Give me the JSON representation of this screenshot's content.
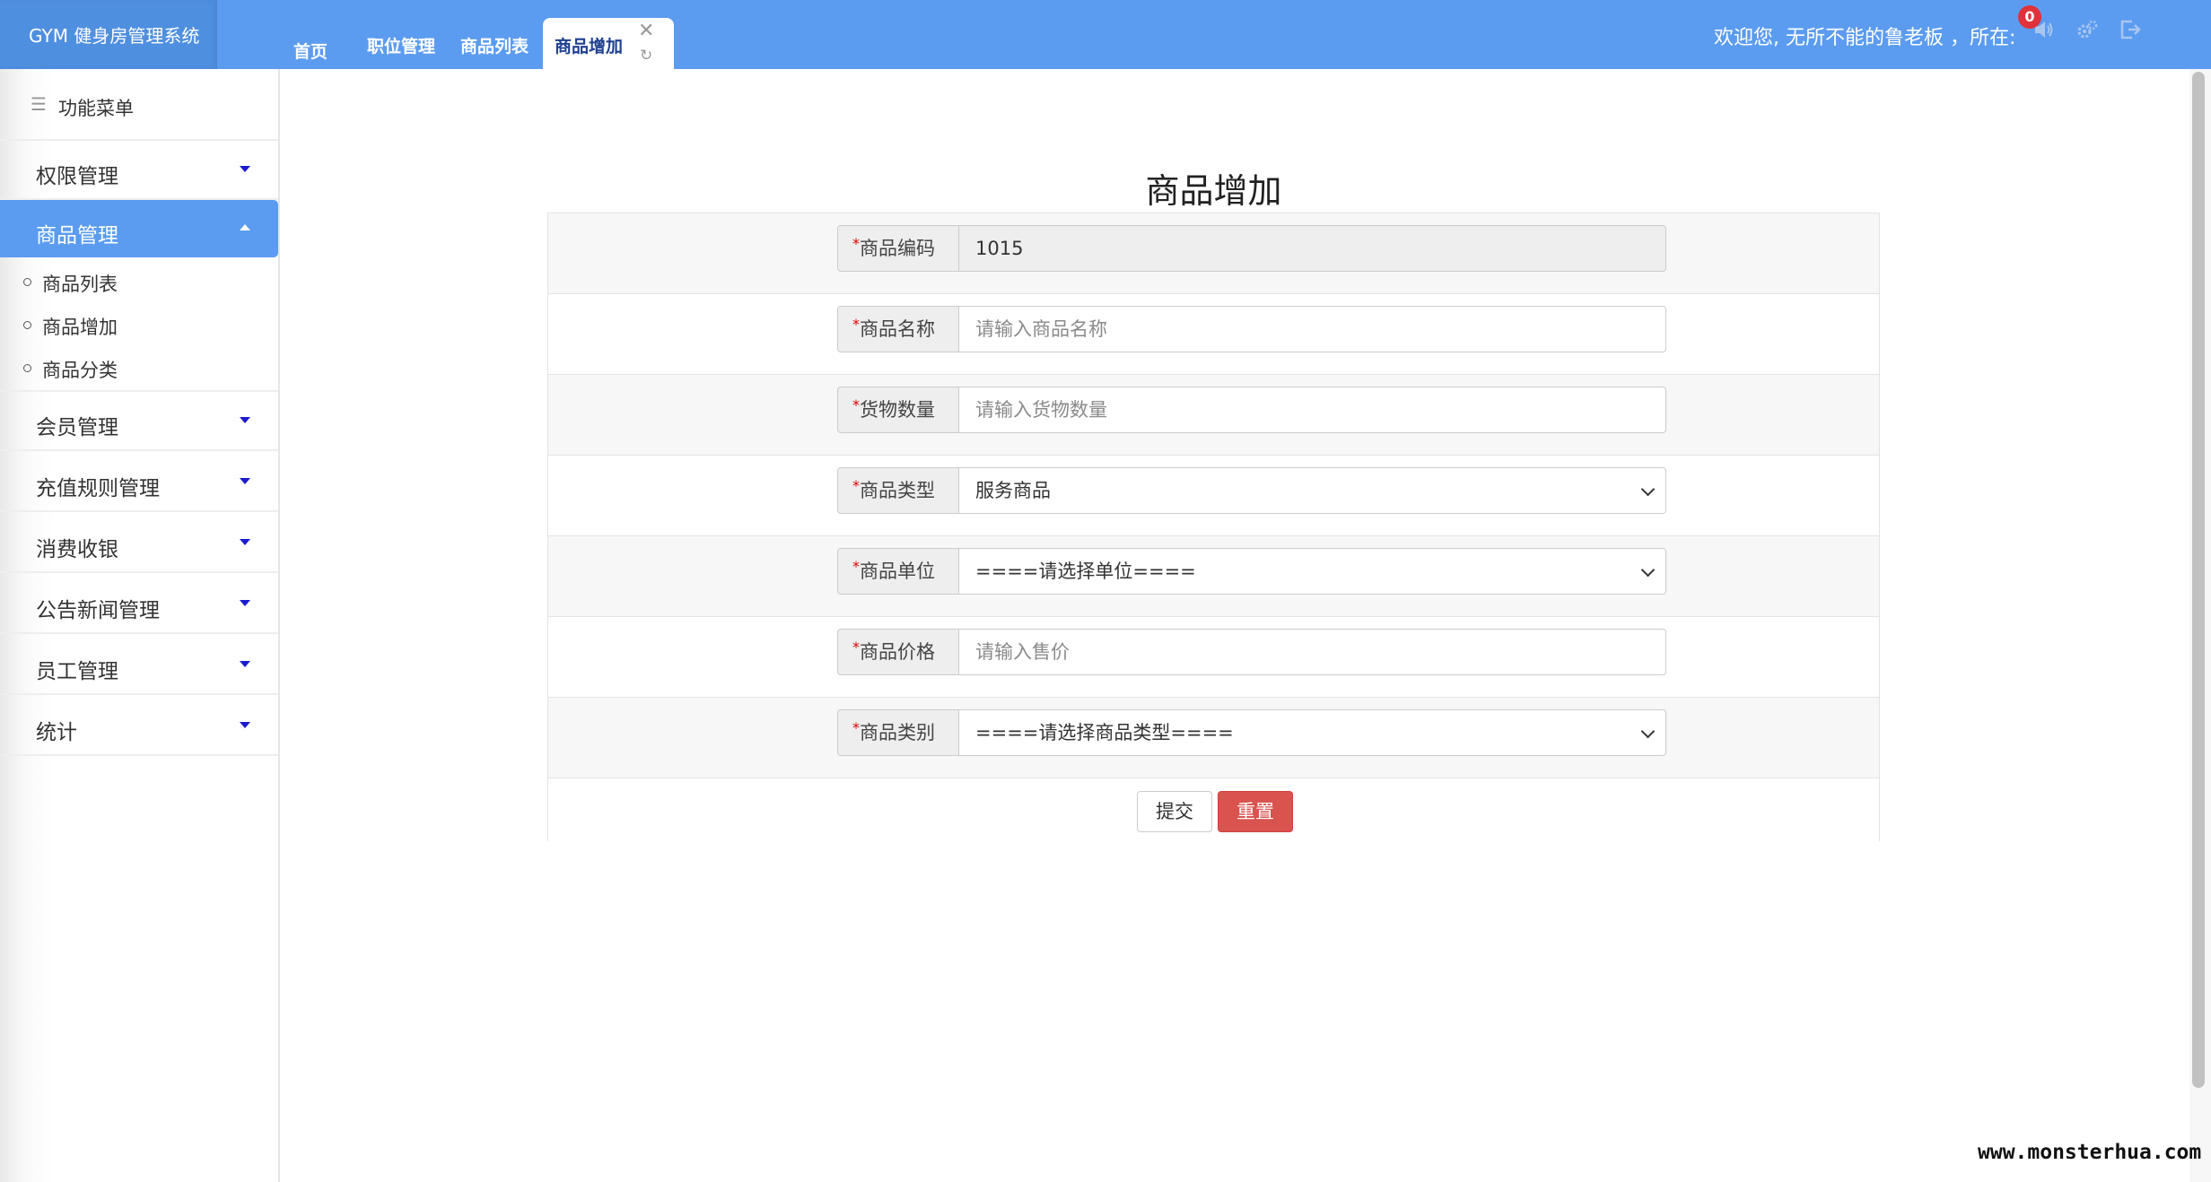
{
  "header": {
    "logo": "GYM 健身房管理系统",
    "tabs": [
      {
        "label": "首页"
      },
      {
        "label": "职位管理"
      },
      {
        "label": "商品列表"
      }
    ],
    "active_tab": {
      "label": "商品增加",
      "close_icon": "close-icon",
      "refresh_icon": "refresh-icon"
    },
    "welcome": "欢迎您, 无所不能的鲁老板 ，所在:",
    "notification_count": "0",
    "icons": [
      "speaker-icon",
      "settings-icon",
      "logout-icon"
    ],
    "color": "#5b9cf0"
  },
  "sidebar": {
    "title": "功能菜单",
    "groups": [
      {
        "label": "权限管理"
      },
      {
        "label": "商品管理",
        "expanded": true
      },
      {
        "label": "会员管理"
      },
      {
        "label": "充值规则管理"
      },
      {
        "label": "消费收银"
      },
      {
        "label": "公告新闻管理"
      },
      {
        "label": "员工管理"
      },
      {
        "label": "统计"
      }
    ],
    "sub_items": [
      {
        "label": "商品列表"
      },
      {
        "label": "商品增加"
      },
      {
        "label": "商品分类"
      }
    ]
  },
  "form": {
    "title": "商品增加",
    "required_mark": "*",
    "fields": [
      {
        "label": "商品编码",
        "value": "1015",
        "placeholder": "",
        "type": "text",
        "readonly": true
      },
      {
        "label": "商品名称",
        "value": "",
        "placeholder": "请输入商品名称",
        "type": "text"
      },
      {
        "label": "货物数量",
        "value": "",
        "placeholder": "请输入货物数量",
        "type": "text"
      },
      {
        "label": "商品类型",
        "value": "服务商品",
        "placeholder": "",
        "type": "select"
      },
      {
        "label": "商品单位",
        "value": "====请选择单位====",
        "placeholder": "",
        "type": "select"
      },
      {
        "label": "商品价格",
        "value": "",
        "placeholder": "请输入售价",
        "type": "text"
      },
      {
        "label": "商品类别",
        "value": "====请选择商品类型====",
        "placeholder": "",
        "type": "select"
      }
    ],
    "submit_label": "提交",
    "reset_label": "重置",
    "reset_color": "#d9534f"
  },
  "watermark": "www.monsterhua.com"
}
